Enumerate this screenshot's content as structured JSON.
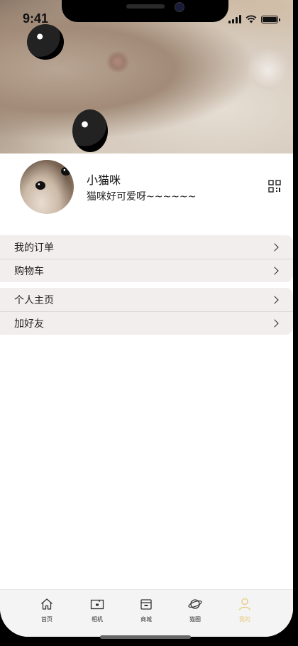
{
  "status_bar": {
    "time": "9:41"
  },
  "profile": {
    "name": "小猫咪",
    "bio": "猫咪好可爱呀~~~~~~"
  },
  "menu_groups": [
    {
      "items": [
        {
          "label": "我的订单"
        },
        {
          "label": "购物车"
        }
      ]
    },
    {
      "items": [
        {
          "label": "个人主页"
        },
        {
          "label": "加好友"
        }
      ]
    }
  ],
  "tabbar": {
    "tabs": [
      {
        "label": "首页",
        "icon": "home-icon"
      },
      {
        "label": "相机",
        "icon": "camera-icon"
      },
      {
        "label": "商城",
        "icon": "store-icon"
      },
      {
        "label": "猫圈",
        "icon": "planet-icon"
      },
      {
        "label": "我的",
        "icon": "user-icon"
      }
    ],
    "active": "我的",
    "active_color": "#e6c97a"
  }
}
